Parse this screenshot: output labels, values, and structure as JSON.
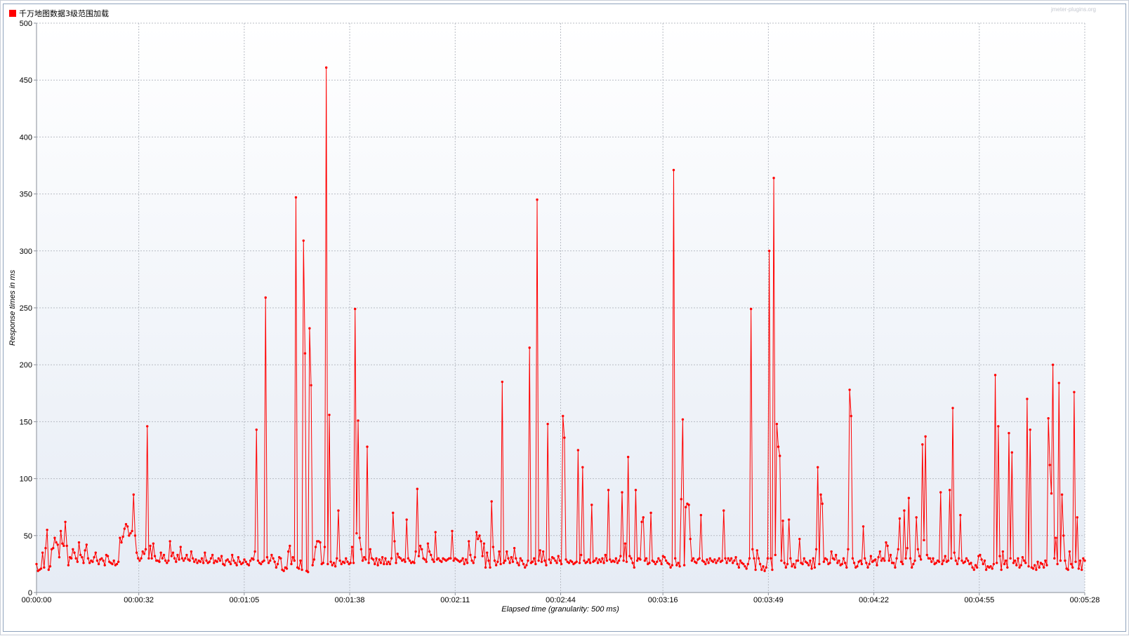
{
  "window": {
    "watermark": "jmeter-plugins.org"
  },
  "colors": {
    "series": "#ff0000",
    "plot_gradient_top": "#ffffff",
    "plot_gradient_bottom": "#e6ecf5",
    "grid": "#b8bcc4",
    "frame_border": "#8fa3bd"
  },
  "chart_data": {
    "type": "line",
    "title": "",
    "xlabel": "Elapsed time (granularity: 500 ms)",
    "ylabel": "Response times in ms",
    "ylim": [
      0,
      500
    ],
    "yticks": [
      0,
      50,
      100,
      150,
      200,
      250,
      300,
      350,
      400,
      450,
      500
    ],
    "ytick_labels": [
      "0",
      "50",
      "100",
      "150",
      "200",
      "250",
      "300",
      "350",
      "400",
      "450",
      "500"
    ],
    "xlim": [
      0,
      328
    ],
    "xticks": [
      0,
      32,
      65,
      98,
      131,
      164,
      196,
      229,
      262,
      295,
      328
    ],
    "xtick_labels": [
      "00:00:00",
      "00:00:32",
      "00:01:05",
      "00:01:38",
      "00:02:11",
      "00:02:44",
      "00:03:16",
      "00:03:49",
      "00:04:22",
      "00:04:55",
      "00:05:28"
    ],
    "granularity_s": 0.5,
    "grid": true,
    "legend_position": "top-left",
    "series": [
      {
        "name": "千万地图数据3级范围加载",
        "color": "#ff0000",
        "values": [
          25,
          19,
          20,
          21,
          35,
          22,
          39,
          55,
          20,
          23,
          38,
          39,
          48,
          44,
          42,
          31,
          54,
          43,
          41,
          62,
          41,
          24,
          31,
          30,
          38,
          35,
          30,
          27,
          44,
          33,
          31,
          26,
          37,
          42,
          30,
          26,
          28,
          27,
          31,
          35,
          28,
          25,
          29,
          30,
          28,
          24,
          33,
          32,
          27,
          26,
          25,
          28,
          24,
          25,
          27,
          48,
          44,
          49,
          56,
          60,
          58,
          50,
          52,
          54,
          86,
          50,
          35,
          30,
          28,
          30,
          36,
          34,
          38,
          146,
          30,
          41,
          30,
          43,
          32,
          28,
          28,
          27,
          35,
          30,
          33,
          28,
          26,
          28,
          45,
          32,
          35,
          30,
          27,
          33,
          29,
          40,
          30,
          28,
          30,
          33,
          29,
          28,
          36,
          30,
          27,
          29,
          26,
          28,
          27,
          30,
          26,
          35,
          28,
          26,
          27,
          30,
          33,
          26,
          28,
          27,
          30,
          28,
          32,
          25,
          24,
          28,
          29,
          27,
          25,
          33,
          28,
          26,
          24,
          31,
          27,
          25,
          26,
          29,
          27,
          25,
          24,
          28,
          30,
          29,
          36,
          143,
          28,
          26,
          25,
          27,
          28,
          259,
          31,
          26,
          28,
          33,
          30,
          27,
          22,
          25,
          31,
          30,
          20,
          19,
          22,
          21,
          36,
          41,
          25,
          31,
          28,
          347,
          22,
          21,
          28,
          20,
          309,
          210,
          19,
          18,
          232,
          182,
          24,
          29,
          40,
          45,
          45,
          44,
          25,
          26,
          40,
          461,
          25,
          156,
          27,
          24,
          26,
          23,
          30,
          72,
          28,
          25,
          27,
          26,
          30,
          27,
          25,
          26,
          40,
          26,
          249,
          52,
          151,
          48,
          38,
          28,
          31,
          29,
          128,
          26,
          38,
          30,
          29,
          25,
          30,
          24,
          29,
          26,
          31,
          25,
          30,
          25,
          27,
          25,
          30,
          70,
          45,
          26,
          34,
          31,
          30,
          28,
          29,
          27,
          64,
          30,
          28,
          26,
          27,
          26,
          36,
          91,
          32,
          41,
          38,
          30,
          29,
          27,
          43,
          36,
          33,
          29,
          27,
          53,
          29,
          30,
          28,
          27,
          30,
          29,
          28,
          29,
          30,
          30,
          54,
          28,
          30,
          29,
          28,
          27,
          28,
          30,
          25,
          29,
          26,
          45,
          33,
          28,
          26,
          31,
          53,
          47,
          50,
          45,
          32,
          43,
          22,
          35,
          28,
          22,
          80,
          40,
          28,
          24,
          27,
          36,
          25,
          185,
          26,
          28,
          36,
          30,
          26,
          31,
          27,
          39,
          30,
          26,
          24,
          30,
          28,
          25,
          22,
          24,
          28,
          215,
          26,
          27,
          30,
          25,
          345,
          28,
          37,
          27,
          36,
          28,
          24,
          148,
          29,
          26,
          31,
          30,
          28,
          26,
          32,
          28,
          25,
          155,
          136,
          29,
          27,
          26,
          28,
          27,
          25,
          26,
          27,
          125,
          26,
          33,
          110,
          28,
          26,
          27,
          29,
          26,
          77,
          27,
          28,
          30,
          26,
          29,
          27,
          30,
          26,
          33,
          28,
          90,
          29,
          27,
          28,
          27,
          30,
          26,
          28,
          32,
          88,
          28,
          43,
          27,
          119,
          32,
          30,
          26,
          22,
          90,
          28,
          30,
          29,
          62,
          66,
          28,
          30,
          25,
          26,
          70,
          28,
          27,
          25,
          27,
          30,
          28,
          25,
          32,
          31,
          28,
          26,
          25,
          22,
          24,
          371,
          30,
          24,
          26,
          23,
          82,
          152,
          24,
          75,
          78,
          77,
          47,
          28,
          30,
          27,
          26,
          29,
          30,
          68,
          28,
          27,
          25,
          29,
          26,
          30,
          28,
          27,
          29,
          26,
          28,
          30,
          27,
          28,
          72,
          30,
          26,
          30,
          28,
          30,
          26,
          28,
          31,
          25,
          22,
          28,
          26,
          25,
          23,
          21,
          25,
          30,
          249,
          38,
          30,
          20,
          37,
          30,
          25,
          20,
          23,
          19,
          22,
          30,
          300,
          30,
          20,
          364,
          33,
          148,
          128,
          120,
          28,
          63,
          26,
          22,
          25,
          64,
          30,
          23,
          25,
          22,
          28,
          28,
          47,
          26,
          25,
          30,
          27,
          26,
          24,
          28,
          21,
          30,
          22,
          38,
          110,
          25,
          86,
          78,
          27,
          30,
          29,
          25,
          26,
          36,
          30,
          29,
          33,
          26,
          28,
          24,
          25,
          30,
          26,
          22,
          38,
          178,
          155,
          30,
          26,
          22,
          23,
          27,
          28,
          25,
          58,
          30,
          26,
          22,
          25,
          32,
          27,
          28,
          29,
          24,
          31,
          36,
          28,
          30,
          28,
          44,
          41,
          28,
          33,
          26,
          26,
          22,
          30,
          38,
          65,
          27,
          25,
          72,
          30,
          39,
          83,
          30,
          22,
          25,
          28,
          66,
          38,
          32,
          29,
          130,
          46,
          137,
          33,
          30,
          30,
          27,
          30,
          25,
          26,
          28,
          27,
          88,
          25,
          28,
          32,
          27,
          28,
          90,
          30,
          162,
          35,
          28,
          25,
          30,
          68,
          28,
          26,
          27,
          30,
          28,
          25,
          26,
          22,
          20,
          24,
          22,
          32,
          33,
          29,
          25,
          28,
          20,
          23,
          22,
          23,
          21,
          25,
          191,
          26,
          146,
          32,
          20,
          36,
          25,
          28,
          22,
          140,
          30,
          123,
          26,
          28,
          24,
          30,
          22,
          24,
          31,
          28,
          26,
          170,
          23,
          143,
          22,
          21,
          24,
          20,
          27,
          22,
          26,
          25,
          22,
          28,
          24,
          153,
          112,
          87,
          200,
          30,
          48,
          25,
          184,
          28,
          86,
          50,
          28,
          21,
          20,
          36,
          25,
          22,
          176,
          27,
          66,
          21,
          28,
          20,
          30,
          28
        ]
      }
    ]
  }
}
